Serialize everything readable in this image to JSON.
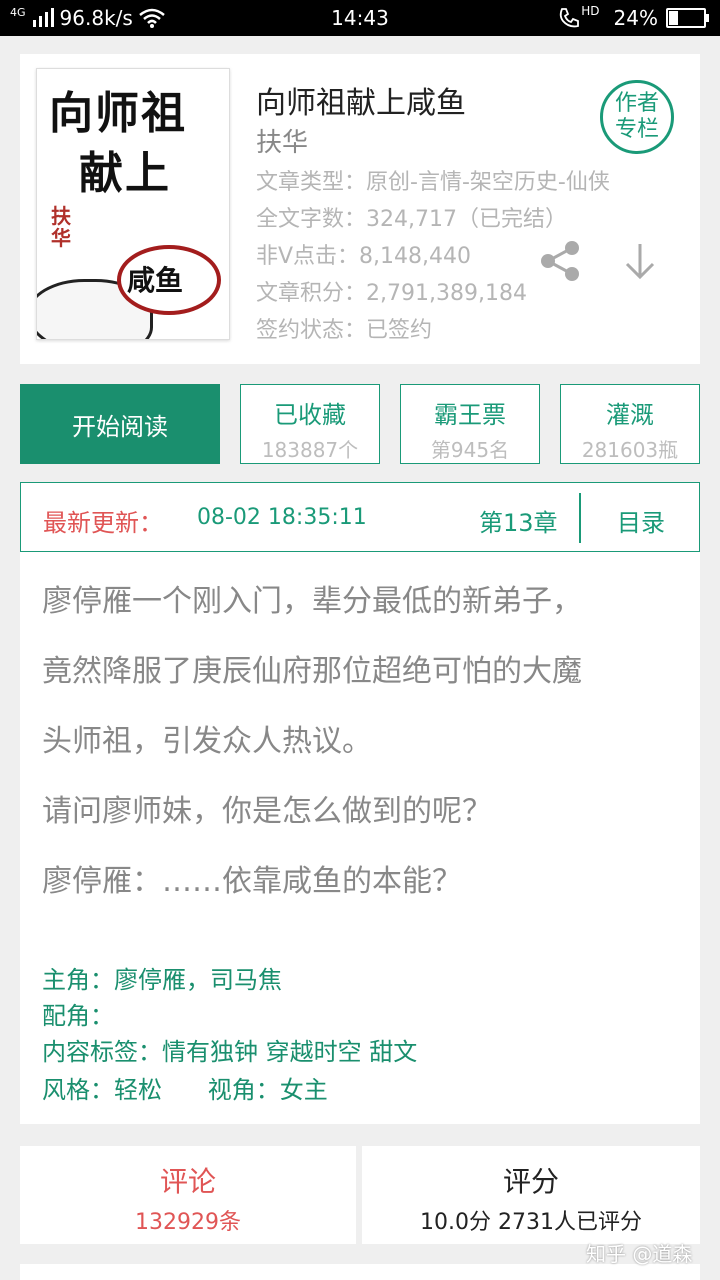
{
  "statusbar": {
    "signal": "4G",
    "speed": "96.8k/s",
    "time": "14:43",
    "hd": "HD",
    "battery": "24%",
    "battery_level": 0.24
  },
  "book": {
    "cover": {
      "line1": "向师祖",
      "line2": "献上",
      "author_mark": "扶华",
      "fish_text": "咸鱼"
    },
    "title": "向师祖献上咸鱼",
    "author": "扶华",
    "meta": [
      "文章类型：原创-言情-架空历史-仙侠",
      "全文字数：324,717（已完结）",
      "非V点击：8,148,440",
      "文章积分：2,791,389,184",
      "签约状态：已签约"
    ],
    "column_button": [
      "作者",
      "专栏"
    ]
  },
  "actions": {
    "read": "开始阅读",
    "stats": [
      {
        "label": "已收藏",
        "value": "183887个"
      },
      {
        "label": "霸王票",
        "value": "第945名"
      },
      {
        "label": "灌溉",
        "value": "281603瓶"
      }
    ]
  },
  "update": {
    "label": "最新更新：",
    "time": "08-02 18:35:11",
    "chapter": "第13章",
    "toc": "目录"
  },
  "intro": {
    "paragraphs": [
      "廖停雁一个刚入门，辈分最低的新弟子，",
      "竟然降服了庚辰仙府那位超绝可怕的大魔",
      "头师祖，引发众人热议。",
      "请问廖师妹，你是怎么做到的呢？",
      "廖停雁：……依靠咸鱼的本能？"
    ],
    "tags": [
      "主角：廖停雁，司马焦",
      "配角：",
      "内容标签：情有独钟 穿越时空 甜文",
      "风格：轻松      视角：女主"
    ]
  },
  "bottom": {
    "comment": {
      "label": "评论",
      "value": "132929条"
    },
    "rating": {
      "label": "评分",
      "value": "10.0分 2731人已评分"
    }
  },
  "watermark": "知乎 @道森",
  "colors": {
    "accent": "#1a8f6e",
    "red": "#e05555",
    "gray": "#b5b5b5"
  }
}
